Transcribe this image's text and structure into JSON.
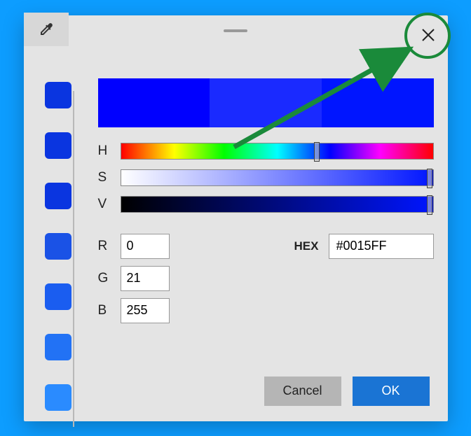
{
  "swatches": [
    "#0a35e0",
    "#0a35e0",
    "#0a35e0",
    "#1a52e6",
    "#1a5df0",
    "#2272f5",
    "#2a8bff"
  ],
  "preview": {
    "left": "#0000ff",
    "mid": "#1a2aff",
    "right": "#0015ff"
  },
  "sliders": {
    "h": {
      "label": "H",
      "thumb_pct": 62
    },
    "s": {
      "label": "S",
      "thumb_pct": 98
    },
    "v": {
      "label": "V",
      "thumb_pct": 98
    }
  },
  "rgb": {
    "r": {
      "label": "R",
      "value": "0"
    },
    "g": {
      "label": "G",
      "value": "21"
    },
    "b": {
      "label": "B",
      "value": "255"
    }
  },
  "hex": {
    "label": "HEX",
    "value": "#0015FF"
  },
  "buttons": {
    "cancel": "Cancel",
    "ok": "OK"
  },
  "annotation": {
    "arrow_color": "#1a8a3a"
  }
}
